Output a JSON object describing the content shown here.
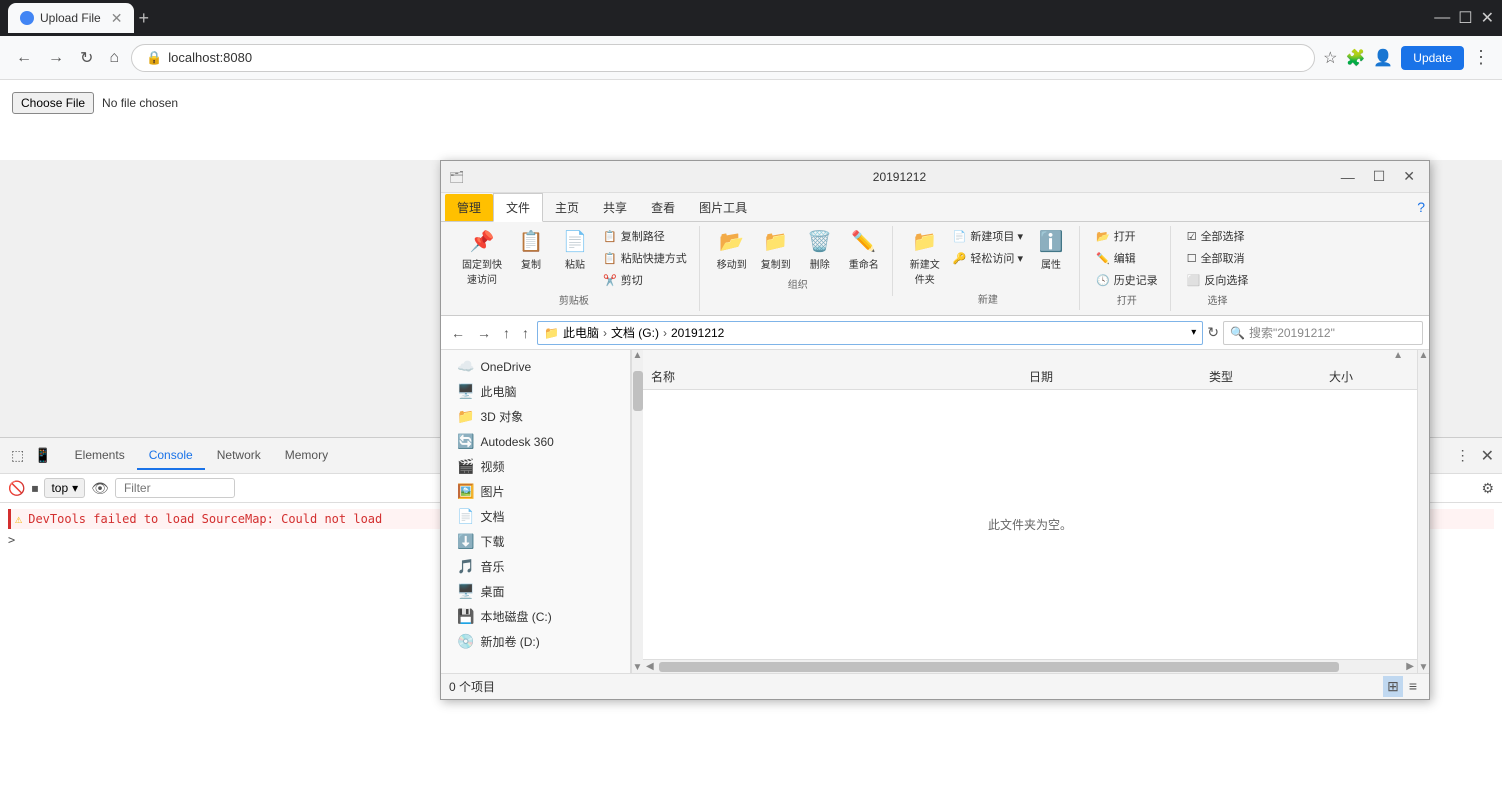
{
  "browser": {
    "tab_title": "Upload File",
    "url": "localhost:8080",
    "update_btn": "Update",
    "favicon": "🌐"
  },
  "page": {
    "choose_file_btn": "Choose File",
    "no_file_text": "No file chosen"
  },
  "devtools": {
    "tabs": [
      "Elements",
      "Console",
      "Network",
      "Memory"
    ],
    "active_tab": "Console",
    "context": "top",
    "filter_placeholder": "Filter",
    "error_message": "DevTools failed to load SourceMap: Could not load",
    "prompt": ">"
  },
  "file_explorer": {
    "title": "20191212",
    "ribbon_tabs": [
      "文件",
      "主页",
      "共享",
      "查看",
      "图片工具"
    ],
    "management_tab": "管理",
    "active_tab": "文件",
    "path_parts": [
      "此电脑",
      "文档 (G:)",
      "20191212"
    ],
    "search_placeholder": "搜索\"20191212\"",
    "ribbon_groups": {
      "clipboard": {
        "label": "剪贴板",
        "items": [
          "固定到快速访问",
          "复制",
          "粘贴",
          "剪切",
          "复制路径",
          "粘贴快捷方式"
        ]
      },
      "organize": {
        "label": "组织",
        "items": [
          "移动到",
          "复制到",
          "删除",
          "重命名"
        ]
      },
      "new": {
        "label": "新建",
        "items": [
          "新建项目",
          "轻松访问",
          "新建文件夹",
          "属性"
        ]
      },
      "open": {
        "label": "打开",
        "items": [
          "打开",
          "编辑",
          "历史记录"
        ]
      },
      "select": {
        "label": "选择",
        "items": [
          "全部选择",
          "全部取消",
          "反向选择"
        ]
      }
    },
    "sidebar_items": [
      {
        "icon": "☁️",
        "label": "OneDrive"
      },
      {
        "icon": "🖥️",
        "label": "此电脑"
      },
      {
        "icon": "📁",
        "label": "3D 对象"
      },
      {
        "icon": "🔄",
        "label": "Autodesk 360"
      },
      {
        "icon": "🎬",
        "label": "视频"
      },
      {
        "icon": "🖼️",
        "label": "图片"
      },
      {
        "icon": "📄",
        "label": "文档"
      },
      {
        "icon": "⬇️",
        "label": "下载"
      },
      {
        "icon": "🎵",
        "label": "音乐"
      },
      {
        "icon": "🖥️",
        "label": "桌面"
      },
      {
        "icon": "💾",
        "label": "本地磁盘 (C:)"
      },
      {
        "icon": "💿",
        "label": "新加卷 (D:)"
      }
    ],
    "column_headers": [
      "名称",
      "日期",
      "类型",
      "大小"
    ],
    "empty_message": "此文件夹为空。",
    "status": "0 个项目",
    "nav_btns": [
      "◀",
      "▶",
      "⬆",
      "⬆"
    ]
  }
}
